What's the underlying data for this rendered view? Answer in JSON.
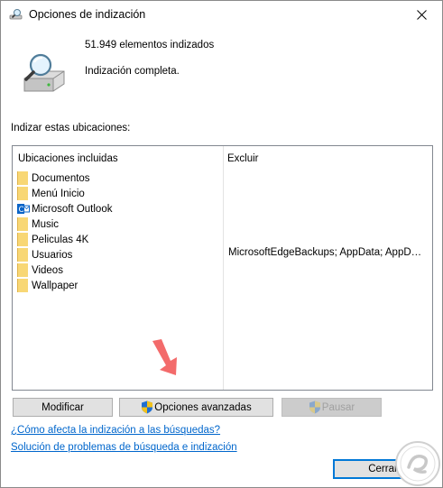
{
  "window": {
    "title": "Opciones de indización",
    "icon": "magnifier-drive-icon"
  },
  "summary": {
    "count_text": "51.949 elementos indizados",
    "status_text": "Indización completa."
  },
  "locations": {
    "section_label": "Indizar estas ubicaciones:",
    "col_included": "Ubicaciones incluidas",
    "col_exclude": "Excluir",
    "items": [
      {
        "label": "Documentos",
        "icon": "folder-icon",
        "exclude": ""
      },
      {
        "label": "Menú Inicio",
        "icon": "folder-icon",
        "exclude": ""
      },
      {
        "label": "Microsoft Outlook",
        "icon": "outlook-icon",
        "exclude": ""
      },
      {
        "label": "Music",
        "icon": "folder-icon",
        "exclude": ""
      },
      {
        "label": "Peliculas 4K",
        "icon": "folder-icon",
        "exclude": ""
      },
      {
        "label": "Usuarios",
        "icon": "folder-icon",
        "exclude": "MicrosoftEdgeBackups; AppData; AppDat..."
      },
      {
        "label": "Videos",
        "icon": "folder-icon",
        "exclude": ""
      },
      {
        "label": "Wallpaper",
        "icon": "folder-icon",
        "exclude": ""
      }
    ]
  },
  "buttons": {
    "modify": "Modificar",
    "advanced": "Opciones avanzadas",
    "pause": "Pausar",
    "close": "Cerrar"
  },
  "links": {
    "help": "¿Cómo afecta la indización a las búsquedas?",
    "troubleshoot": "Solución de problemas de búsqueda e indización"
  },
  "colors": {
    "link": "#0066cc",
    "accent": "#0078d7",
    "folder": "#f8d775",
    "arrow": "#f36b6b"
  }
}
